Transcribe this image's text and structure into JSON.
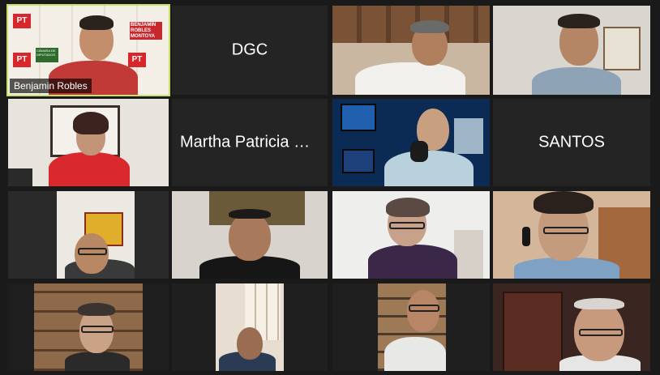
{
  "participants": [
    {
      "name": "Benjamin Robles",
      "video": true,
      "speaking": true
    },
    {
      "name": "DGC",
      "video": false
    },
    {
      "video": true
    },
    {
      "video": true
    },
    {
      "video": true
    },
    {
      "name": "Martha Patricia Ra...",
      "video": false
    },
    {
      "video": true
    },
    {
      "name": "SANTOS",
      "video": false
    },
    {
      "video": true
    },
    {
      "video": true
    },
    {
      "video": true
    },
    {
      "video": true
    },
    {
      "video": true
    },
    {
      "video": true
    },
    {
      "video": true
    },
    {
      "video": true
    }
  ],
  "backdrop_text": [
    "BENJAMIN ROBLES MONTOYA",
    "PT",
    "CÁMARA DE DIPUTADOS"
  ],
  "colors": {
    "active_border": "#c9e265",
    "tile_bg": "#242424",
    "page_bg": "#1a1a1a"
  }
}
